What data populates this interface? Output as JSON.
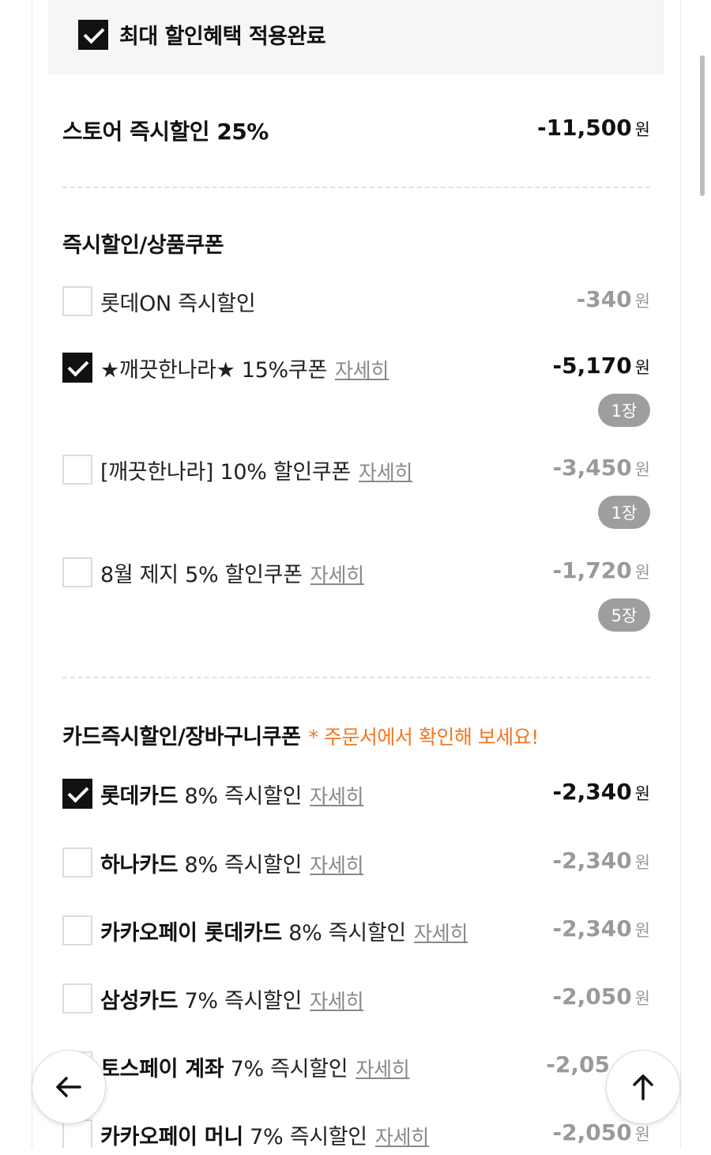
{
  "banner": {
    "text": "최대 할인혜택 적용완료",
    "checked": true
  },
  "store": {
    "label": "스토어 즉시할인 25%",
    "amount": "-11,500",
    "unit": "원"
  },
  "section1": {
    "title": "즉시할인/상품쿠폰",
    "items": [
      {
        "label": "롯데ON 즉시할인",
        "detail": "",
        "amount": "-340",
        "unit": "원",
        "checked": false,
        "qty": ""
      },
      {
        "label": "★깨끗한나라★ 15%쿠폰",
        "detail": "자세히",
        "amount": "-5,170",
        "unit": "원",
        "checked": true,
        "qty": "1장"
      },
      {
        "label": "[깨끗한나라] 10% 할인쿠폰",
        "detail": "자세히",
        "amount": "-3,450",
        "unit": "원",
        "checked": false,
        "qty": "1장"
      },
      {
        "label": "8월 제지 5% 할인쿠폰",
        "detail": "자세히",
        "amount": "-1,720",
        "unit": "원",
        "checked": false,
        "qty": "5장"
      }
    ]
  },
  "section2": {
    "title": "카드즉시할인/장바구니쿠폰",
    "note": "* 주문서에서 확인해 보세요!",
    "items": [
      {
        "brand": "롯데카드",
        "rest": " 8% 즉시할인",
        "detail": "자세히",
        "amount": "-2,340",
        "unit": "원",
        "checked": true
      },
      {
        "brand": "하나카드",
        "rest": " 8% 즉시할인",
        "detail": "자세히",
        "amount": "-2,340",
        "unit": "원",
        "checked": false
      },
      {
        "brand": "카카오페이 롯데카드",
        "rest": " 8% 즉시할인",
        "detail": "자세히",
        "amount": "-2,340",
        "unit": "원",
        "checked": false
      },
      {
        "brand": "삼성카드",
        "rest": " 7% 즉시할인",
        "detail": "자세히",
        "amount": "-2,050",
        "unit": "원",
        "checked": false
      },
      {
        "brand": "토스페이 계좌",
        "rest": " 7% 즉시할인",
        "detail": "자세히",
        "amount": "-2,05",
        "unit": "",
        "checked": false
      },
      {
        "brand": "카카오페이 머니",
        "rest": " 7% 즉시할인",
        "detail": "자세히",
        "amount": "-2,050",
        "unit": "원",
        "checked": false
      }
    ]
  },
  "nav": {
    "back_icon": "arrow-left-icon",
    "top_icon": "arrow-up-icon"
  },
  "colors": {
    "accent": "#f07822",
    "checked": "#111111",
    "muted": "#9a9a9a"
  }
}
